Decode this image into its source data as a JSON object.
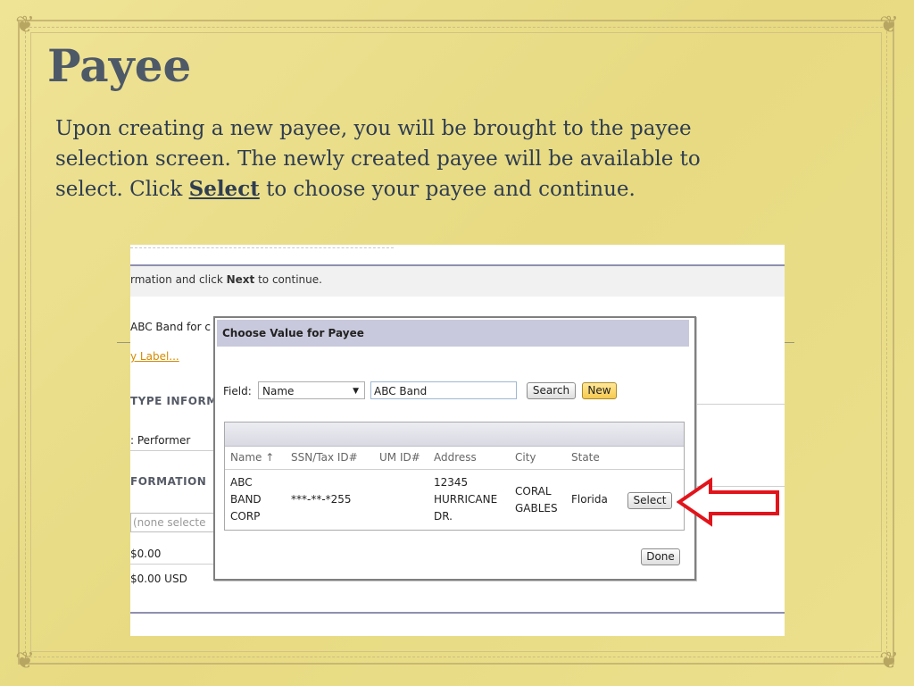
{
  "slide": {
    "title": "Payee",
    "body_part1": "Upon creating a new payee, you will be brought to the payee selection screen. The newly created payee will be available to select. Click ",
    "body_emphasis": "Select",
    "body_part2": " to choose your payee and continue."
  },
  "screenshot": {
    "instruction_prefix": "rmation and click ",
    "instruction_bold": "Next",
    "instruction_suffix": " to continue.",
    "bg_rows": {
      "name_value": "ABC Band for c",
      "label_link": "y Label...",
      "type_section": "TYPE INFORM",
      "type_value": ": Performer",
      "formation_section": "FORMATION",
      "none_selected": "(none selecte",
      "amount1": "$0.00",
      "amount2": "$0.00 USD"
    },
    "modal": {
      "title": "Choose Value for Payee",
      "field_label": "Field:",
      "field_select_value": "Name",
      "search_value": "ABC Band",
      "search_button": "Search",
      "new_button": "New",
      "done_button": "Done",
      "columns": [
        "Name  ↑",
        "SSN/Tax ID#",
        "UM ID#",
        "Address",
        "City",
        "State"
      ],
      "row": {
        "name_lines": [
          "ABC",
          "BAND",
          "CORP"
        ],
        "ssn": "***-**-*255",
        "um_id": "",
        "address_lines": [
          "12345",
          "HURRICANE",
          "DR."
        ],
        "city_lines": [
          "CORAL",
          "GABLES"
        ],
        "state": "Florida",
        "select_button": "Select"
      }
    }
  },
  "colors": {
    "slide_background": "#ecdf8a",
    "title_color": "#4e5968",
    "body_text_color": "#2f3d50",
    "modal_header": "#c9c9dd",
    "new_button": "#f6c94e",
    "arrow": "#e2141b"
  },
  "icons": {
    "dropdown": "chevron-down-icon",
    "sort": "sort-ascending-icon",
    "callout": "arrow-left-icon"
  }
}
